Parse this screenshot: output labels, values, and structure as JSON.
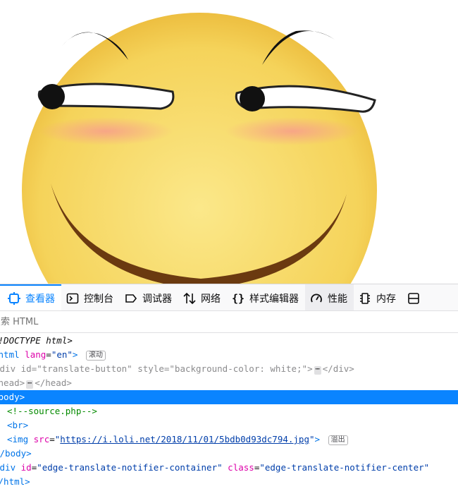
{
  "devtools": {
    "tabs": [
      {
        "label": "查看器",
        "icon": "inspector-icon",
        "selected": true
      },
      {
        "label": "控制台",
        "icon": "console-icon"
      },
      {
        "label": "调试器",
        "icon": "debugger-icon"
      },
      {
        "label": "网络",
        "icon": "network-icon"
      },
      {
        "label": "样式编辑器",
        "icon": "style-editor-icon"
      },
      {
        "label": "性能",
        "icon": "performance-icon"
      },
      {
        "label": "内存",
        "icon": "memory-icon"
      }
    ],
    "search_placeholder": "搜索 HTML",
    "tree": {
      "doctype": "<!DOCTYPE html>",
      "html_tag": "<html",
      "html_lang_attr": "lang",
      "html_lang_val": "\"en\"",
      "html_close_bracket": ">",
      "scroll_badge": "滚动",
      "div_open": "<div",
      "div_id_attr": "id",
      "div_id_val": "\"translate-button\"",
      "div_style_attr": "style",
      "div_style_val": "\"background-color: white;\"",
      "div_bracket": ">",
      "ellipsis": "⋯",
      "div_close": "</div>",
      "head_open": "<head>",
      "head_close": "</head>",
      "body_open": "<body>",
      "comment": "<!--source.php-->",
      "br": "<br>",
      "img_open": "<img",
      "img_src_attr": "src",
      "img_src_val": "https://i.loli.net/2018/11/01/5bdb0d93dc794.jpg",
      "img_close": ">",
      "overflow_badge": "溢出",
      "body_close": "</body>",
      "div2_open": "<div",
      "div2_id_attr": "id",
      "div2_id_val": "\"edge-translate-notifier-container\"",
      "div2_class_attr": "class",
      "div2_class_val": "\"edge-translate-notifier-center\"",
      "html_close": "</html>"
    }
  }
}
